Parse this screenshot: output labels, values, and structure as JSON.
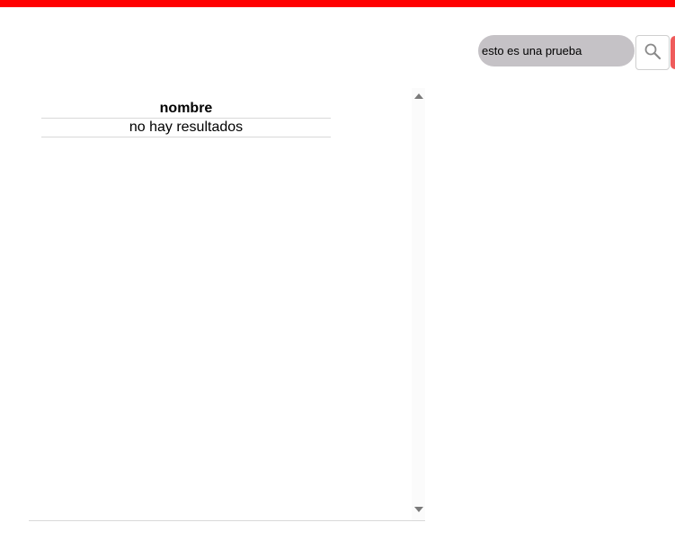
{
  "search": {
    "value": "esto es una prueba",
    "button_icon": "search-icon"
  },
  "colors": {
    "top_bar": "#ff0000",
    "search_field_bg": "#c5c2c6",
    "red_button": "#ef5b5b"
  },
  "results_table": {
    "columns": [
      "nombre"
    ],
    "empty_message": "no hay resultados"
  }
}
